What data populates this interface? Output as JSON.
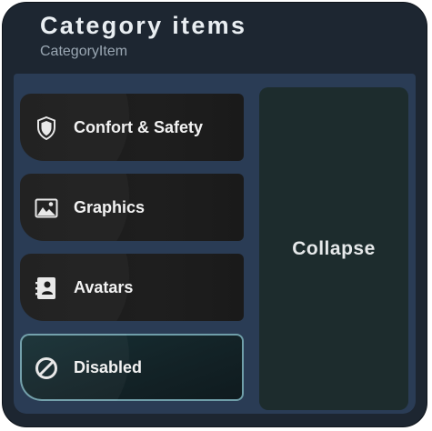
{
  "window": {
    "title": "Category items",
    "subtitle": "CategoryItem"
  },
  "items": [
    {
      "label": "Confort & Safety",
      "icon": "shield-icon",
      "selected": false
    },
    {
      "label": "Graphics",
      "icon": "image-icon",
      "selected": false
    },
    {
      "label": "Avatars",
      "icon": "avatar-card-icon",
      "selected": false
    },
    {
      "label": "Disabled",
      "icon": "blocked-icon",
      "selected": true
    }
  ],
  "collapse": {
    "label": "Collapse"
  },
  "colors": {
    "panel": "#1d2631",
    "body": "#2a3c55",
    "item": "#1c1c1c",
    "selected_border": "#6f9ea9",
    "collapse_bg": "#1d2c2d"
  }
}
